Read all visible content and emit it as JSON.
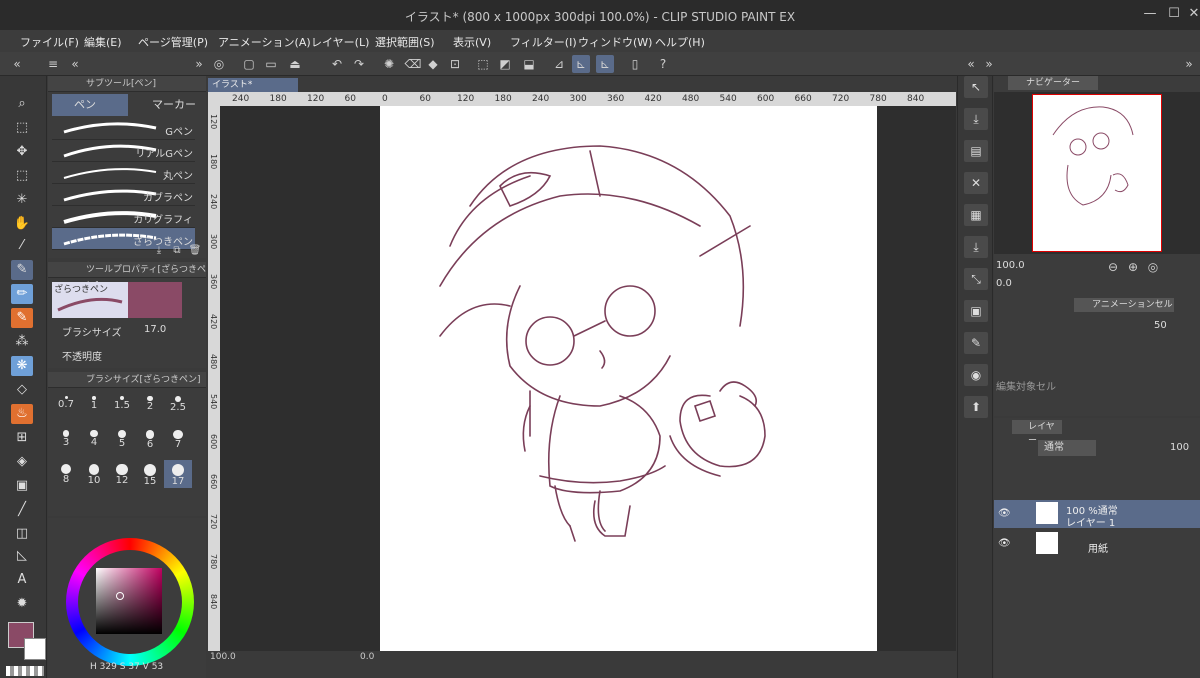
{
  "window": {
    "title": "イラスト* (800 x 1000px 300dpi 100.0%) - CLIP STUDIO PAINT EX"
  },
  "menu": [
    "ファイル(F)",
    "編集(E)",
    "ページ管理(P)",
    "アニメーション(A)",
    "レイヤー(L)",
    "選択範囲(S)",
    "表示(V)",
    "フィルター(I)",
    "ウィンドウ(W)",
    "ヘルプ(H)"
  ],
  "subtool": {
    "header": "サブツール[ペン]",
    "tabs": [
      "ペン",
      "マーカー"
    ],
    "brushes": [
      "Gペン",
      "リアルGペン",
      "丸ペン",
      "カブラペン",
      "カリグラフィ",
      "ざらつきペン"
    ]
  },
  "toolprop": {
    "header": "ツールプロパティ[ざらつきペン]",
    "preview_name": "ざらつきペン",
    "size_label": "ブラシサイズ",
    "size_value": "17.0",
    "opacity_label": "不透明度"
  },
  "brushsize": {
    "header": "ブラシサイズ[ざらつきペン]",
    "sizes": [
      "0.7",
      "1",
      "1.5",
      "2",
      "2.5",
      "3",
      "4",
      "5",
      "6",
      "7",
      "8",
      "10",
      "12",
      "15",
      "17"
    ],
    "selected": "17"
  },
  "color": {
    "main": "#8a4a66",
    "sub": "#ffffff",
    "hsv": {
      "h_label": "H",
      "h": "329",
      "s_label": "S",
      "s": "37",
      "v_label": "V",
      "v": "53"
    }
  },
  "document": {
    "tab": "イラスト*",
    "ruler_ticks": [
      "240",
      "180",
      "120",
      "60",
      "0",
      "60",
      "120",
      "180",
      "240",
      "300",
      "360",
      "420",
      "480",
      "540",
      "600",
      "660",
      "720",
      "780",
      "840"
    ],
    "ruler_v_ticks": [
      "120",
      "180",
      "240",
      "300",
      "360",
      "420",
      "480",
      "540",
      "600",
      "660",
      "720",
      "780",
      "840"
    ]
  },
  "status": {
    "zoom": "100.0",
    "rotate": "0.0"
  },
  "navigator": {
    "tab": "ナビゲーター",
    "zoom": "100.0",
    "rotate": "0.0"
  },
  "animcel": {
    "tab": "アニメーションセル",
    "opacity": "50",
    "hint": "編集対象セル"
  },
  "layers": {
    "tab": "レイヤー",
    "blend": "通常",
    "opacity": "100",
    "items": [
      {
        "line1": "100 %通常",
        "line2": "レイヤー 1"
      },
      {
        "line1": "",
        "line2": "用紙"
      }
    ]
  }
}
